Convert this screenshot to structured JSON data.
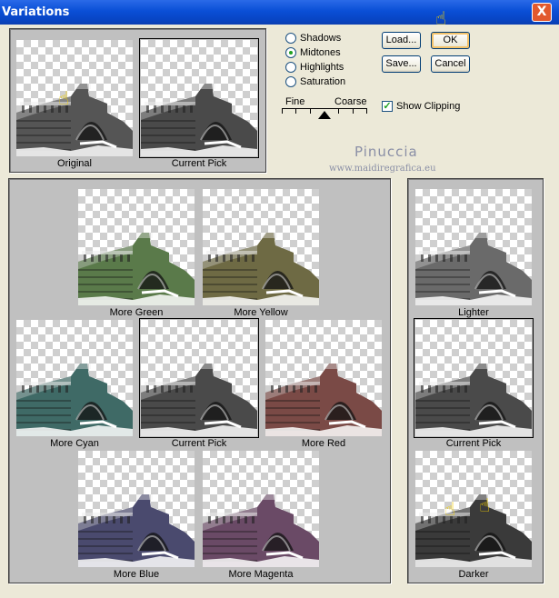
{
  "window": {
    "title": "Variations",
    "close": "X"
  },
  "top": {
    "original": "Original",
    "current": "Current Pick"
  },
  "radios": [
    {
      "label": "Shadows",
      "on": false
    },
    {
      "label": "Midtones",
      "on": true
    },
    {
      "label": "Highlights",
      "on": false
    },
    {
      "label": "Saturation",
      "on": false
    }
  ],
  "slider": {
    "fine": "Fine",
    "coarse": "Coarse"
  },
  "buttons": {
    "load": "Load...",
    "ok": "OK",
    "save": "Save...",
    "cancel": "Cancel"
  },
  "show_clipping": "Show Clipping",
  "watermark": {
    "name": "Pinuccia",
    "url": "www.maidiregrafica.eu"
  },
  "color_grid": {
    "green": "More Green",
    "yellow": "More Yellow",
    "cyan": "More Cyan",
    "current": "Current Pick",
    "red": "More Red",
    "blue": "More Blue",
    "magenta": "More Magenta"
  },
  "bright": {
    "lighter": "Lighter",
    "current": "Current Pick",
    "darker": "Darker"
  },
  "tints": {
    "original": "#555555",
    "current": "#4a4a4a",
    "green": "#5a7a4a",
    "yellow": "#6e6a44",
    "cyan": "#3f6a66",
    "red": "#7a4a46",
    "blue": "#4a4a6e",
    "magenta": "#6a4a66",
    "lighter": "#6a6a6a",
    "darker": "#3a3a3a"
  }
}
